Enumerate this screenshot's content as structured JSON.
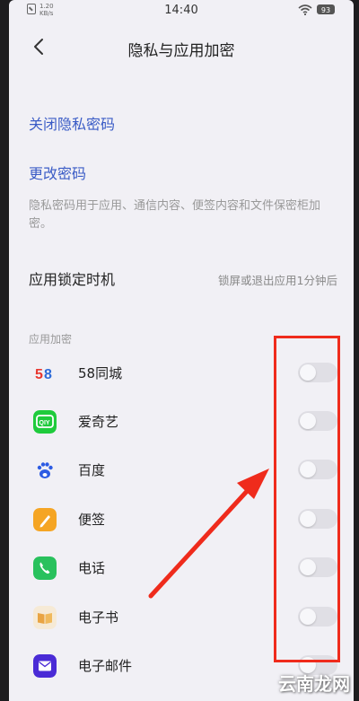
{
  "status_bar": {
    "speed_value": "1.20",
    "speed_unit": "KB/s",
    "time": "14:40",
    "battery": "93",
    "signal_icon": "sim-icon",
    "wifi_icon": "wifi-icon"
  },
  "header": {
    "back_icon": "back-chevron-icon",
    "title": "隐私与应用加密"
  },
  "settings": {
    "close_privacy_password": "关闭隐私密码",
    "change_password": "更改密码",
    "description": "隐私密码用于应用、通信内容、便签内容和文件保密柜加密。",
    "lock_timing_label": "应用锁定时机",
    "lock_timing_value": "锁屏或退出应用1分钟后"
  },
  "app_encryption": {
    "section_title": "应用加密",
    "apps": [
      {
        "name": "58同城",
        "icon": "58-icon",
        "enabled": false
      },
      {
        "name": "爱奇艺",
        "icon": "iqiyi-icon",
        "enabled": false
      },
      {
        "name": "百度",
        "icon": "baidu-icon",
        "enabled": false
      },
      {
        "name": "便签",
        "icon": "notes-icon",
        "enabled": false
      },
      {
        "name": "电话",
        "icon": "phone-icon",
        "enabled": false
      },
      {
        "name": "电子书",
        "icon": "ebook-icon",
        "enabled": false
      },
      {
        "name": "电子邮件",
        "icon": "email-icon",
        "enabled": false
      }
    ]
  },
  "colors": {
    "link": "#3b5cc6",
    "highlight": "#ef2b1c",
    "toggle_off": "#e0dfe5"
  },
  "watermark": "云南龙网"
}
